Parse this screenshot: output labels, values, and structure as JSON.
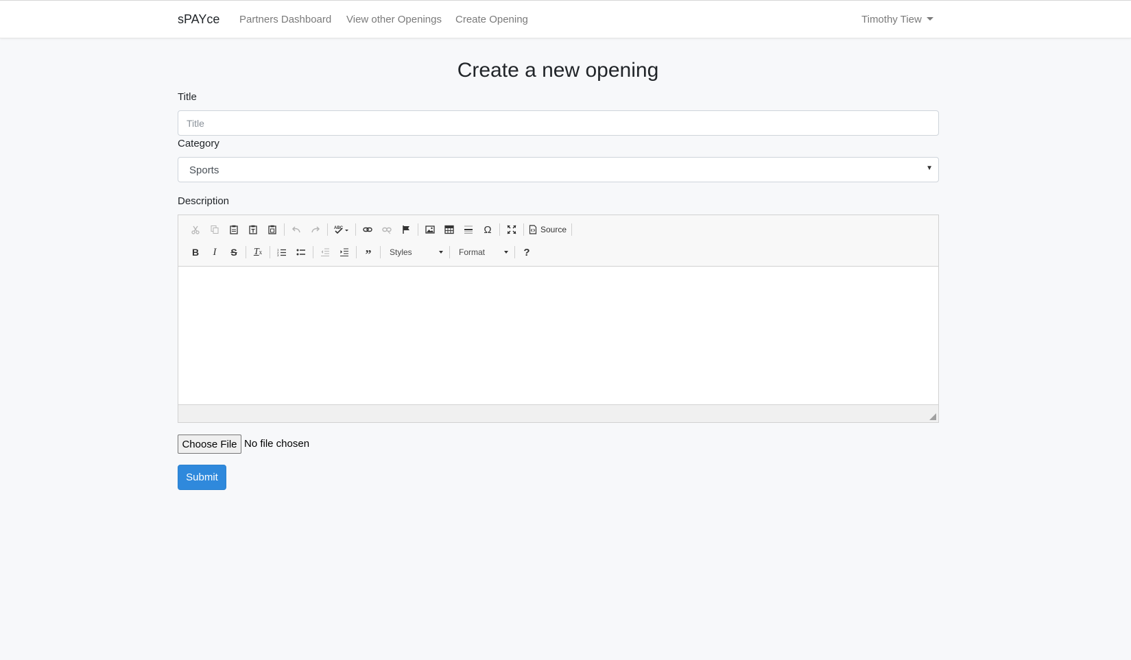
{
  "navbar": {
    "brand": "sPAYce",
    "links": [
      "Partners Dashboard",
      "View other Openings",
      "Create Opening"
    ],
    "user": "Timothy Tiew"
  },
  "page": {
    "title": "Create a new opening"
  },
  "form": {
    "title_label": "Title",
    "title_placeholder": "Title",
    "category_label": "Category",
    "category_value": "Sports",
    "description_label": "Description",
    "editor": {
      "source_label": "Source",
      "styles_label": "Styles",
      "format_label": "Format",
      "help_label": "?"
    },
    "file_button": "Choose File",
    "file_status": "No file chosen",
    "submit_label": "Submit"
  },
  "colors": {
    "primary": "#2f89dc",
    "background": "#f7f8fa"
  }
}
